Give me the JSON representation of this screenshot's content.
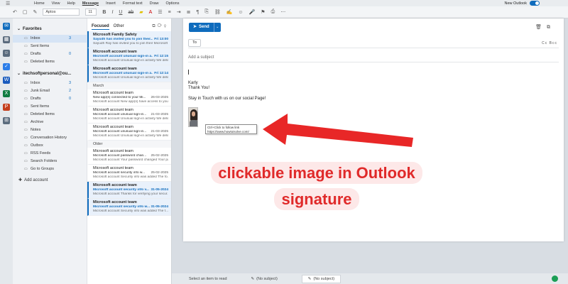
{
  "menubar": {
    "items": [
      "Home",
      "View",
      "Help",
      "Message",
      "Insert",
      "Format text",
      "Draw",
      "Options"
    ],
    "active_index": 3,
    "new_outlook_label": "New Outlook"
  },
  "ribbon": {
    "font_name": "Aptos",
    "font_size": "11"
  },
  "folders": {
    "favorites_header": "Favorites",
    "favorites": [
      {
        "label": "Inbox",
        "count": "3",
        "selected": true
      },
      {
        "label": "Sent Items",
        "count": ""
      },
      {
        "label": "Drafts",
        "count": "0"
      },
      {
        "label": "Deleted Items",
        "count": ""
      }
    ],
    "account_header": "itechsoftpersonal@ou...",
    "account": [
      {
        "label": "Inbox",
        "count": "3"
      },
      {
        "label": "Junk Email",
        "count": "2"
      },
      {
        "label": "Drafts",
        "count": "0"
      },
      {
        "label": "Sent Items",
        "count": ""
      },
      {
        "label": "Deleted Items",
        "count": ""
      },
      {
        "label": "Archive",
        "count": ""
      },
      {
        "label": "Notes",
        "count": ""
      },
      {
        "label": "Conversation History",
        "count": ""
      },
      {
        "label": "Outbox",
        "count": ""
      },
      {
        "label": "RSS Feeds",
        "count": ""
      },
      {
        "label": "Search Folders",
        "count": ""
      },
      {
        "label": "Go to Groups",
        "count": ""
      }
    ],
    "add_account": "Add account"
  },
  "msglist": {
    "tab_focused": "Focused",
    "tab_other": "Other",
    "groups": [
      {
        "label": "",
        "messages": [
          {
            "from": "Microsoft Family Safety",
            "subject": "Sayudh has invited you to join their...",
            "date": "Fri 13:00",
            "preview": "Sayudh Ray has invited you to join their Microsoft Fa...",
            "unread": true
          },
          {
            "from": "Microsoft account team",
            "subject": "Microsoft account unusual sign-in a...",
            "date": "Fri 12:15",
            "preview": "Microsoft account Unusual sign-in activity We detecte...",
            "unread": true
          },
          {
            "from": "Microsoft account team",
            "subject": "Microsoft account unusual sign-in a...",
            "date": "Fri 12:14",
            "preview": "Microsoft account Unusual sign-in activity We detecte...",
            "unread": true
          }
        ]
      },
      {
        "label": "March",
        "messages": [
          {
            "from": "Microsoft account team",
            "subject": "New app(s) connected to your Mi...",
            "date": "26-03-2025",
            "preview": "Microsoft account New app(s) have access to your...",
            "unread": false
          },
          {
            "from": "Microsoft account team",
            "subject": "Microsoft account unusual sign-in...",
            "date": "21-03-2025",
            "preview": "Microsoft account Unusual sign-in activity We dete...",
            "unread": false
          },
          {
            "from": "Microsoft account team",
            "subject": "Microsoft account unusual sign-in...",
            "date": "21-03-2025",
            "preview": "Microsoft account Unusual sign-in activity We dete...",
            "unread": false
          }
        ]
      },
      {
        "label": "Older",
        "messages": [
          {
            "from": "Microsoft account team",
            "subject": "Microsoft account password chan...",
            "date": "25-02-2025",
            "preview": "Microsoft account Your password changed Your pa...",
            "unread": false
          },
          {
            "from": "Microsoft account team",
            "subject": "Microsoft account security info w...",
            "date": "25-02-2025",
            "preview": "Microsoft account Security info was added The fo...",
            "unread": false
          },
          {
            "from": "Microsoft account team",
            "subject": "Microsoft account security info v...",
            "date": "31-05-2024",
            "preview": "Microsoft account Thanks for verifying your secur...",
            "unread": true
          },
          {
            "from": "Microsoft account team",
            "subject": "Microsoft account security info w...",
            "date": "31-05-2024",
            "preview": "Microsoft account Security info was added The f...",
            "unread": true
          }
        ]
      }
    ]
  },
  "compose": {
    "send_label": "Send",
    "to_label": "To",
    "cc_bcc": "Cc  Bcc",
    "subject_placeholder": "Add a subject",
    "sig_name": "Karly",
    "sig_thanks": "Thank You!",
    "sig_stay": "Stay in Touch with us on our social Page!",
    "tooltip_line1": "Ctrl+Click to follow link",
    "tooltip_line2": "https://www.howtoisolve.com/"
  },
  "annotation": {
    "line1": "clickable image in Outlook",
    "line2": "signature",
    "color": "#e02a2a"
  },
  "bottombar": {
    "status": "Select an item to read",
    "draft_tab1": "(No subject)",
    "draft_tab2": "(No subject)"
  }
}
